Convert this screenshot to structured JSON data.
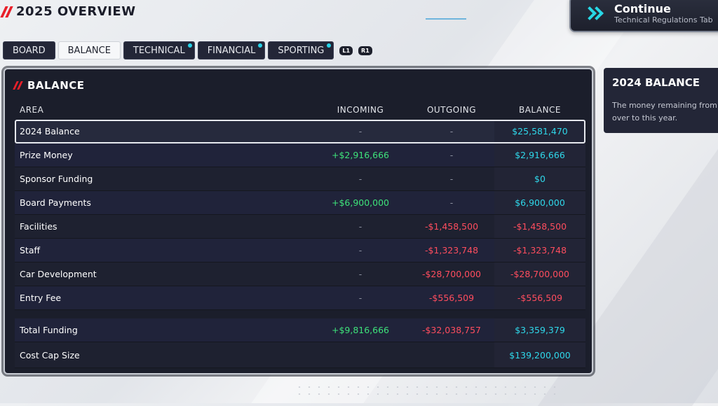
{
  "header": {
    "title": "2025 OVERVIEW"
  },
  "continue": {
    "label": "Continue",
    "sub": "Technical Regulations Tab"
  },
  "tabs": [
    {
      "label": "BOARD",
      "active": false,
      "dot": false
    },
    {
      "label": "BALANCE",
      "active": true,
      "dot": false
    },
    {
      "label": "TECHNICAL",
      "active": false,
      "dot": true
    },
    {
      "label": "FINANCIAL",
      "active": false,
      "dot": true
    },
    {
      "label": "SPORTING",
      "active": false,
      "dot": true
    }
  ],
  "shoulders": {
    "left": "L1",
    "right": "R1"
  },
  "panel": {
    "title": "BALANCE",
    "columns": {
      "area": "AREA",
      "incoming": "INCOMING",
      "outgoing": "OUTGOING",
      "balance": "BALANCE"
    },
    "rows": [
      {
        "area": "2024 Balance",
        "incoming": "-",
        "outgoing": "-",
        "balance": "$25,581,470"
      },
      {
        "area": "Prize Money",
        "incoming": "+$2,916,666",
        "outgoing": "-",
        "balance": "$2,916,666"
      },
      {
        "area": "Sponsor Funding",
        "incoming": "-",
        "outgoing": "-",
        "balance": "$0"
      },
      {
        "area": "Board Payments",
        "incoming": "+$6,900,000",
        "outgoing": "-",
        "balance": "$6,900,000"
      },
      {
        "area": "Facilities",
        "incoming": "-",
        "outgoing": "-$1,458,500",
        "balance": "-$1,458,500"
      },
      {
        "area": "Staff",
        "incoming": "-",
        "outgoing": "-$1,323,748",
        "balance": "-$1,323,748"
      },
      {
        "area": "Car Development",
        "incoming": "-",
        "outgoing": "-$28,700,000",
        "balance": "-$28,700,000"
      },
      {
        "area": "Entry Fee",
        "incoming": "-",
        "outgoing": "-$556,509",
        "balance": "-$556,509"
      }
    ],
    "totals": [
      {
        "area": "Total Funding",
        "incoming": "+$9,816,666",
        "outgoing": "-$32,038,757",
        "balance": "$3,359,379"
      },
      {
        "area": "Cost Cap Size",
        "incoming": "",
        "outgoing": "",
        "balance": "$139,200,000"
      }
    ]
  },
  "side": {
    "title": "2024 BALANCE",
    "line1": "The money remaining from l",
    "line2": "over to this year."
  },
  "colors": {
    "positive": "#3ee27a",
    "negative": "#ff4d5e",
    "balance": "#2fd8ea",
    "accent": "#e8202a",
    "dot": "#27d3e8"
  }
}
